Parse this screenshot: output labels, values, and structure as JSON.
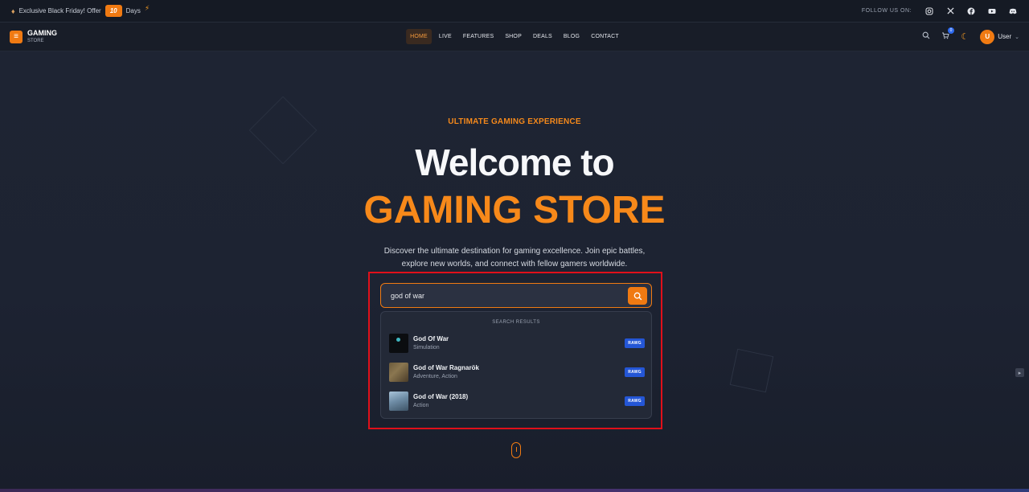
{
  "topbar": {
    "promo_text": "Exclusive Black Friday! Offer",
    "days_count": "10",
    "days_label": "Days",
    "follow_label": "FOLLOW US ON:",
    "social_icons": [
      "instagram-icon",
      "x-icon",
      "facebook-icon",
      "youtube-icon",
      "discord-icon"
    ]
  },
  "navbar": {
    "brand_name": "GAMING",
    "brand_sub": "STORE",
    "menu": [
      {
        "label": "HOME",
        "active": true
      },
      {
        "label": "LIVE"
      },
      {
        "label": "FEATURES"
      },
      {
        "label": "SHOP"
      },
      {
        "label": "DEALS"
      },
      {
        "label": "BLOG"
      },
      {
        "label": "CONTACT"
      }
    ],
    "cart_count": "0",
    "user_initial": "U",
    "user_name": "User"
  },
  "hero": {
    "eyebrow": "ULTIMATE GAMING EXPERIENCE",
    "title_line1": "Welcome to",
    "title_line2": "GAMING STORE",
    "description": "Discover the ultimate destination for gaming excellence. Join epic battles, explore new worlds, and connect with fellow gamers worldwide."
  },
  "search": {
    "value": "god of war",
    "results_header": "SEARCH RESULTS",
    "results": [
      {
        "title": "God Of War",
        "genre": "Simulation",
        "tag": "RAWG"
      },
      {
        "title": "God of War Ragnarök",
        "genre": "Adventure, Action",
        "tag": "RAWG"
      },
      {
        "title": "God of War (2018)",
        "genre": "Action",
        "tag": "RAWG"
      }
    ]
  },
  "colors": {
    "accent": "#f07a12",
    "background": "#1c2230",
    "tag_blue": "#2456d6",
    "highlight_red": "#e0101a"
  }
}
